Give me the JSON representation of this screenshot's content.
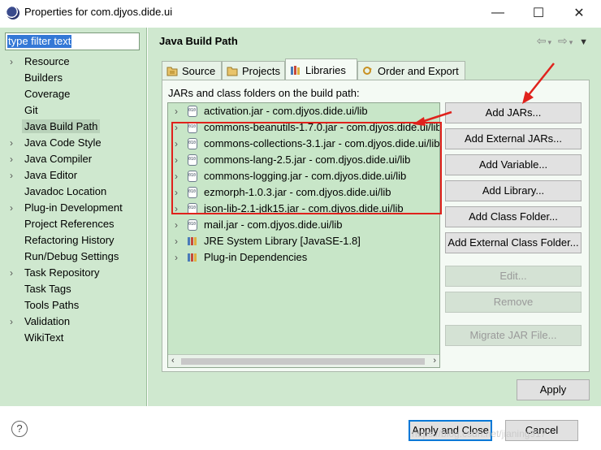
{
  "window": {
    "title": "Properties for com.djyos.dide.ui",
    "minimize": "—",
    "maximize": "☐",
    "close": "✕"
  },
  "filter": {
    "text": "type filter text"
  },
  "nav": {
    "items": [
      {
        "label": "Resource",
        "expandable": true
      },
      {
        "label": "Builders",
        "expandable": false
      },
      {
        "label": "Coverage",
        "expandable": false
      },
      {
        "label": "Git",
        "expandable": false
      },
      {
        "label": "Java Build Path",
        "expandable": false,
        "selected": true
      },
      {
        "label": "Java Code Style",
        "expandable": true
      },
      {
        "label": "Java Compiler",
        "expandable": true
      },
      {
        "label": "Java Editor",
        "expandable": true
      },
      {
        "label": "Javadoc Location",
        "expandable": false
      },
      {
        "label": "Plug-in Development",
        "expandable": true
      },
      {
        "label": "Project References",
        "expandable": false
      },
      {
        "label": "Refactoring History",
        "expandable": false
      },
      {
        "label": "Run/Debug Settings",
        "expandable": false
      },
      {
        "label": "Task Repository",
        "expandable": true
      },
      {
        "label": "Task Tags",
        "expandable": false
      },
      {
        "label": "Tools Paths",
        "expandable": false
      },
      {
        "label": "Validation",
        "expandable": true
      },
      {
        "label": "WikiText",
        "expandable": false
      }
    ]
  },
  "page": {
    "title": "Java Build Path"
  },
  "tabs": [
    {
      "label": "Source",
      "icon": "source-folder-icon"
    },
    {
      "label": "Projects",
      "icon": "projects-folder-icon"
    },
    {
      "label": "Libraries",
      "icon": "libraries-icon",
      "active": true
    },
    {
      "label": "Order and Export",
      "icon": "order-export-icon"
    }
  ],
  "libraries": {
    "caption": "JARs and class folders on the build path:",
    "entries": [
      {
        "label": "activation.jar - com.djyos.dide.ui/lib",
        "kind": "jar"
      },
      {
        "label": "commons-beanutils-1.7.0.jar - com.djyos.dide.ui/lib",
        "kind": "jar"
      },
      {
        "label": "commons-collections-3.1.jar - com.djyos.dide.ui/lib",
        "kind": "jar"
      },
      {
        "label": "commons-lang-2.5.jar - com.djyos.dide.ui/lib",
        "kind": "jar"
      },
      {
        "label": "commons-logging.jar - com.djyos.dide.ui/lib",
        "kind": "jar"
      },
      {
        "label": "ezmorph-1.0.3.jar - com.djyos.dide.ui/lib",
        "kind": "jar"
      },
      {
        "label": "json-lib-2.1-jdk15.jar - com.djyos.dide.ui/lib",
        "kind": "jar"
      },
      {
        "label": "mail.jar - com.djyos.dide.ui/lib",
        "kind": "jar"
      },
      {
        "label": "JRE System Library [JavaSE-1.8]",
        "kind": "library"
      },
      {
        "label": "Plug-in Dependencies",
        "kind": "library"
      }
    ]
  },
  "buttons": {
    "add_jars": "Add JARs...",
    "add_external_jars": "Add External JARs...",
    "add_variable": "Add Variable...",
    "add_library": "Add Library...",
    "add_class_folder": "Add Class Folder...",
    "add_external_class_folder": "Add External Class Folder...",
    "edit": "Edit...",
    "remove": "Remove",
    "migrate_jar": "Migrate JAR File...",
    "apply": "Apply",
    "apply_and_close": "Apply and Close",
    "cancel": "Cancel"
  },
  "help_icon": "?",
  "watermark": "https://blog.csdn.net/jianing917",
  "colors": {
    "pane_bg": "#cfe8cf",
    "selection": "#3478d6",
    "annotation_red": "#e0221c",
    "default_button_border": "#0078d7"
  }
}
